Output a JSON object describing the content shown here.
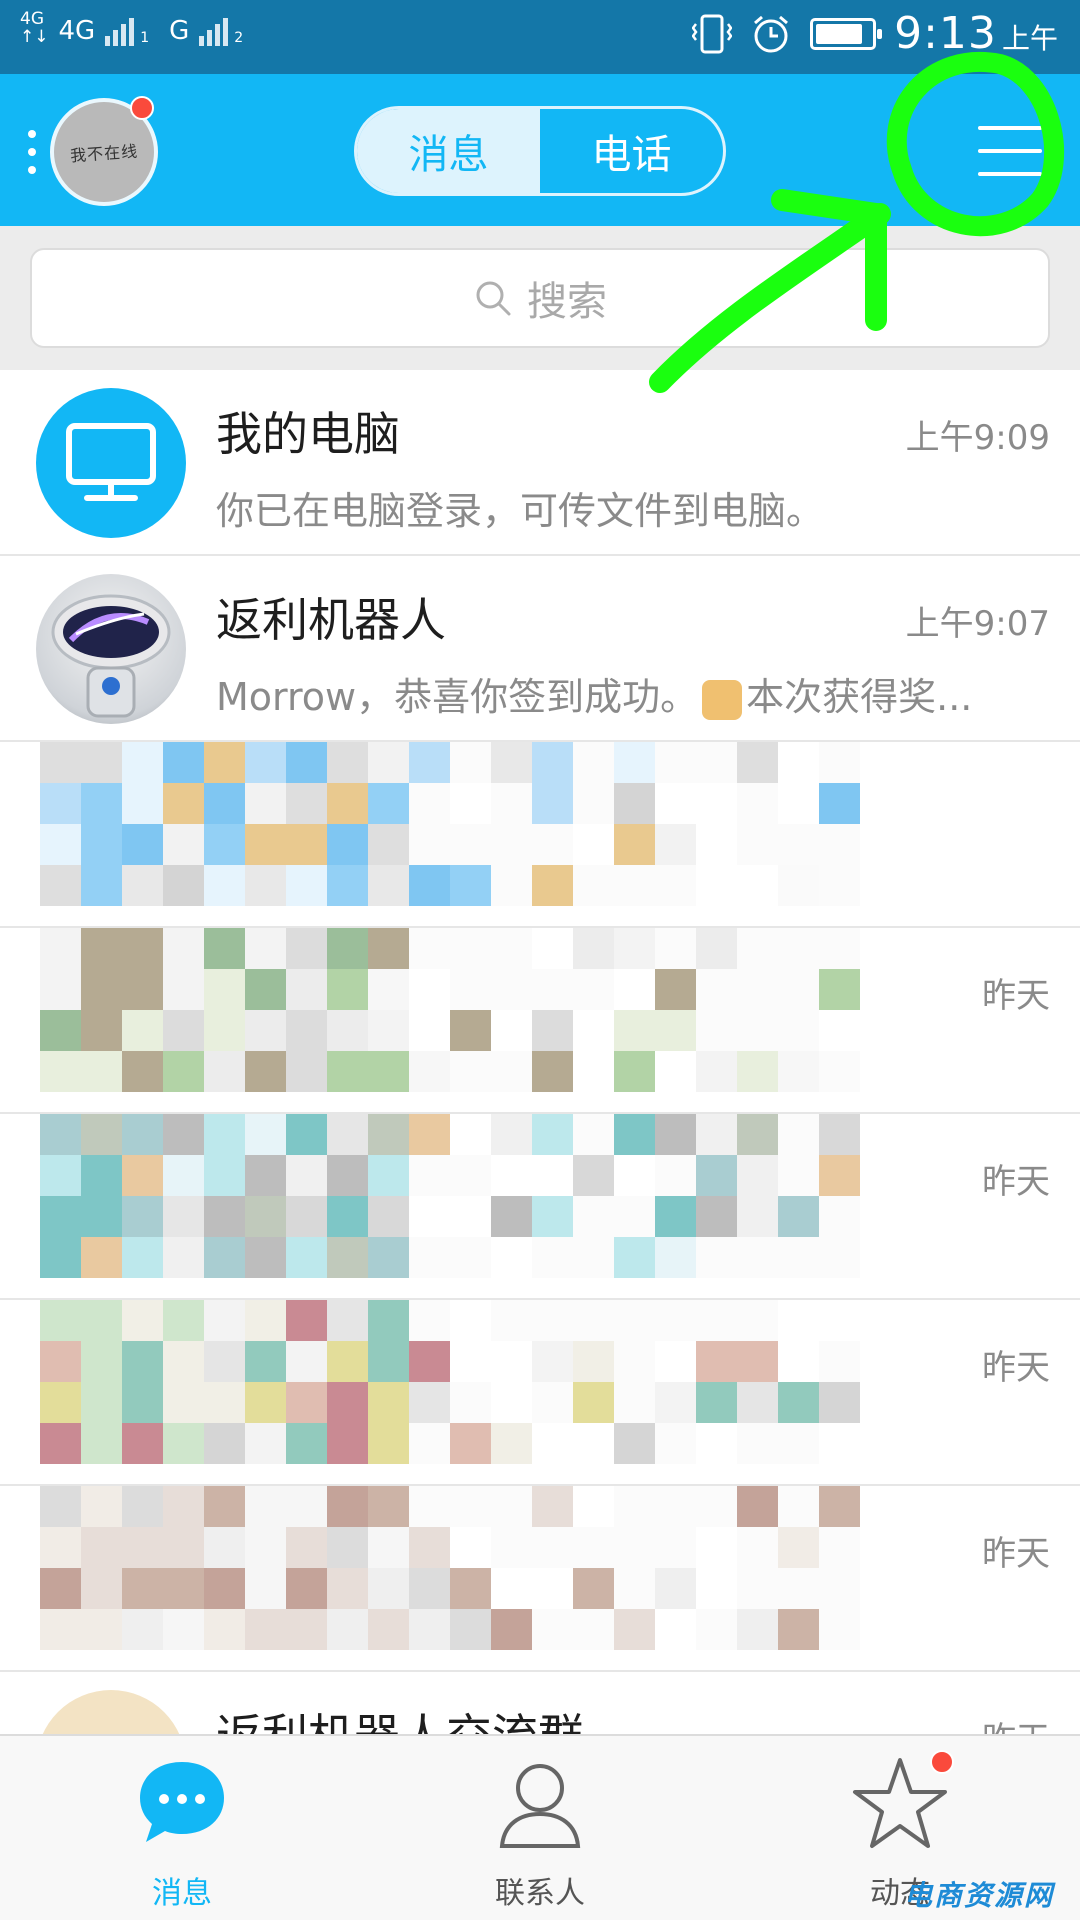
{
  "status_bar": {
    "net1": "4G",
    "net1_sub": "↑↓",
    "net2": "4G",
    "sim1": "1",
    "carrier2": "G",
    "sim2": "2",
    "time": "9:13",
    "ampm": "上午",
    "icons": [
      "vibrate-icon",
      "alarm-icon",
      "battery-icon"
    ],
    "battery_level": 0.85
  },
  "header": {
    "avatar_text": "我不在线",
    "tabs": [
      {
        "label": "消息",
        "active": true
      },
      {
        "label": "电话",
        "active": false
      }
    ],
    "menu_icon": "hamburger-icon",
    "accent_color": "#12b7f5"
  },
  "search": {
    "placeholder": "搜索",
    "icon": "search-icon"
  },
  "conversations": [
    {
      "title": "我的电脑",
      "time": "上午9:09",
      "preview": "你已在电脑登录，可传文件到电脑。",
      "avatar": "monitor-icon"
    },
    {
      "title": "返利机器人",
      "time": "上午9:07",
      "preview_a": "Morrow，恭喜你签到成功。",
      "preview_b": "本次获得奖...",
      "avatar": "robot-avatar"
    },
    {
      "title": "",
      "time": "",
      "preview": ""
    },
    {
      "title": "",
      "time": "昨天",
      "preview": ""
    },
    {
      "title": "",
      "time": "昨天",
      "preview": ""
    },
    {
      "title": "",
      "time": "昨天",
      "preview": ""
    },
    {
      "title": "",
      "time": "昨天",
      "preview": ""
    },
    {
      "title": "返利机器人交流群",
      "time": "昨天",
      "preview": ""
    }
  ],
  "tab_bar": {
    "tabs": [
      {
        "label": "消息",
        "icon": "chat-bubble-icon",
        "active": true
      },
      {
        "label": "联系人",
        "icon": "contact-icon",
        "active": false
      },
      {
        "label": "动态",
        "icon": "star-icon",
        "active": false,
        "badge": true
      }
    ]
  },
  "watermark": "电商资源网"
}
